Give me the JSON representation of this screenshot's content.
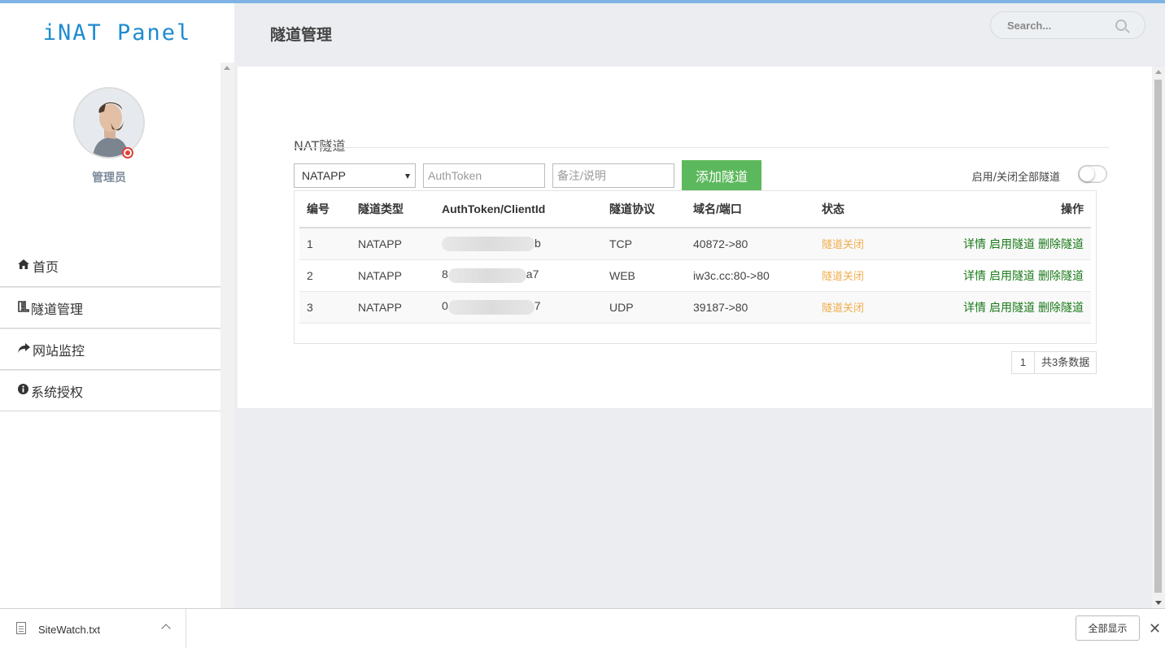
{
  "app": {
    "brand": "iNAT Panel"
  },
  "user": {
    "name": "管理员"
  },
  "sidebar": {
    "items": [
      {
        "label": "首页",
        "icon": "home-icon"
      },
      {
        "label": "隧道管理",
        "icon": "tunnel-icon"
      },
      {
        "label": "网站监控",
        "icon": "share-arrow-icon"
      },
      {
        "label": "系统授权",
        "icon": "info-icon"
      }
    ]
  },
  "header": {
    "title": "隧道管理",
    "search_placeholder": "Search..."
  },
  "panel": {
    "title": "NAT隧道",
    "type_select": "NATAPP",
    "token_placeholder": "AuthToken",
    "note_placeholder": "备注/说明",
    "add_button": "添加隧道",
    "toggle_label": "启用/关闭全部隧道"
  },
  "table": {
    "headers": [
      "编号",
      "隧道类型",
      "AuthToken/ClientId",
      "隧道协议",
      "域名/端口",
      "状态",
      "操作"
    ],
    "rows": [
      {
        "id": "1",
        "type": "NATAPP",
        "token_head": "",
        "token_tail": "b",
        "protocol": "TCP",
        "target": "40872->80",
        "status": "隧道关闭"
      },
      {
        "id": "2",
        "type": "NATAPP",
        "token_head": "8",
        "token_tail": "a7",
        "protocol": "WEB",
        "target": "iw3c.cc:80->80",
        "status": "隧道关闭"
      },
      {
        "id": "3",
        "type": "NATAPP",
        "token_head": "0",
        "token_tail": "7",
        "protocol": "UDP",
        "target": "39187->80",
        "status": "隧道关闭"
      }
    ],
    "actions": {
      "detail": "详情",
      "enable": "启用隧道",
      "delete": "删除隧道"
    }
  },
  "pager": {
    "page": "1",
    "total": "共3条数据"
  },
  "downloads": {
    "file": "SiteWatch.txt",
    "show_all": "全部显示"
  },
  "colors": {
    "accent": "#1e8bd0",
    "add_button": "#5cb85c",
    "status_off": "#f0ad4e",
    "action": "#1a7a1a"
  }
}
